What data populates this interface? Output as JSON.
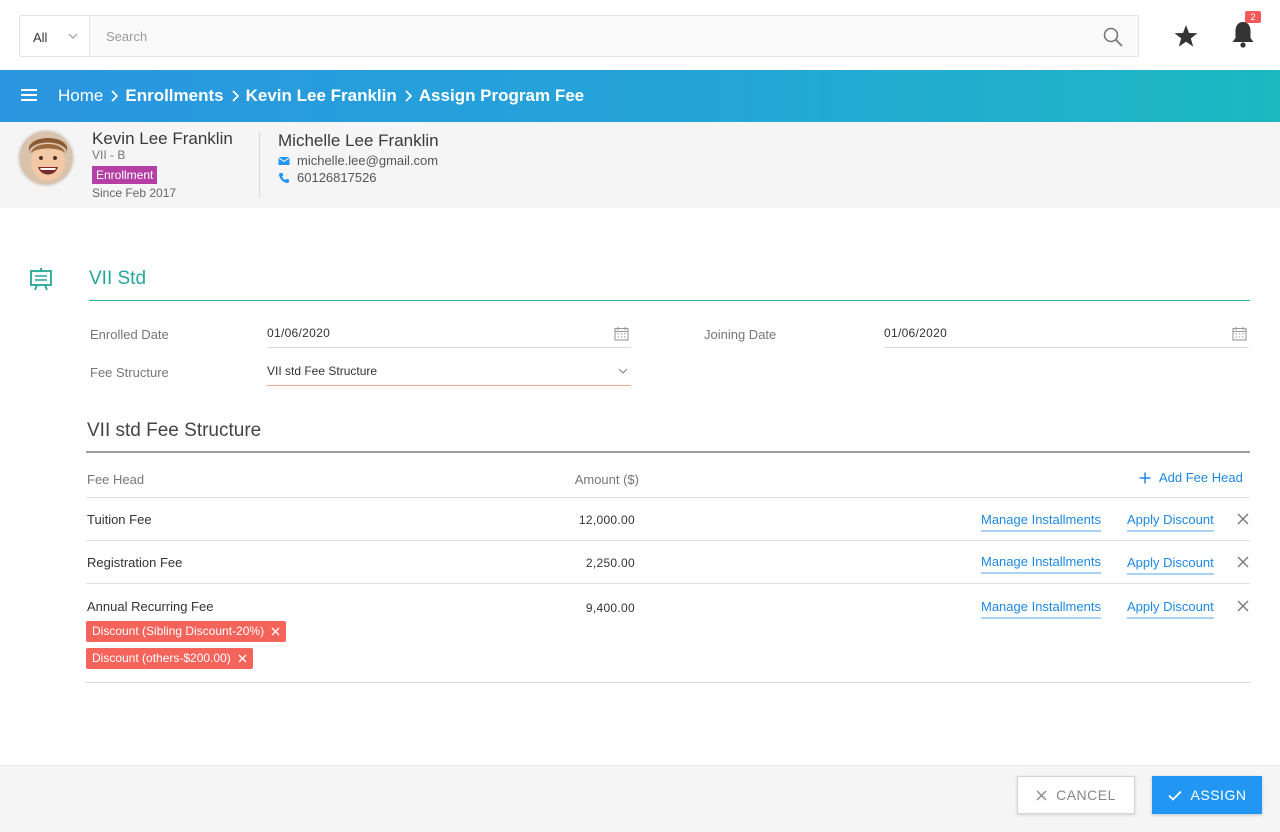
{
  "search": {
    "scope_label": "All",
    "placeholder": "Search",
    "value": ""
  },
  "notifications": {
    "count": "2"
  },
  "breadcrumb": {
    "items": [
      "Home",
      "Enrollments",
      "Kevin Lee Franklin",
      "Assign Program Fee"
    ]
  },
  "student": {
    "name": "Kevin Lee Franklin",
    "class": "VII - B",
    "status": "Enrollment",
    "since": "Since Feb 2017"
  },
  "parent": {
    "name": "Michelle Lee Franklin",
    "email": "michelle.lee@gmail.com",
    "phone": "60126817526"
  },
  "section": {
    "title": "VII Std",
    "icon": "presentation-board-icon"
  },
  "form": {
    "enrolled_date_label": "Enrolled Date",
    "enrolled_date": "01/06/2020",
    "joining_date_label": "Joining Date",
    "joining_date": "01/06/2020",
    "fee_structure_label": "Fee Structure",
    "fee_structure": "VII std Fee Structure"
  },
  "fee_structure": {
    "title": "VII std Fee Structure",
    "col_fee_head": "Fee Head",
    "col_amount": "Amount ($)",
    "add_label": "Add Fee Head",
    "manage_label": "Manage Installments",
    "discount_label": "Apply Discount",
    "rows": [
      {
        "name": "Tuition Fee",
        "amount": "12,000.00"
      },
      {
        "name": "Registration Fee",
        "amount": "2,250.00"
      },
      {
        "name": "Annual Recurring Fee",
        "amount": "9,400.00"
      }
    ],
    "discounts": [
      "Discount (Sibling Discount-20%)",
      "Discount (others-$200.00)"
    ]
  },
  "footer": {
    "cancel_label": "CANCEL",
    "assign_label": "ASSIGN"
  },
  "colors": {
    "accent": "#2196f3",
    "teal": "#26a69a",
    "badge": "#b53fa5",
    "chip": "#f4645b"
  }
}
